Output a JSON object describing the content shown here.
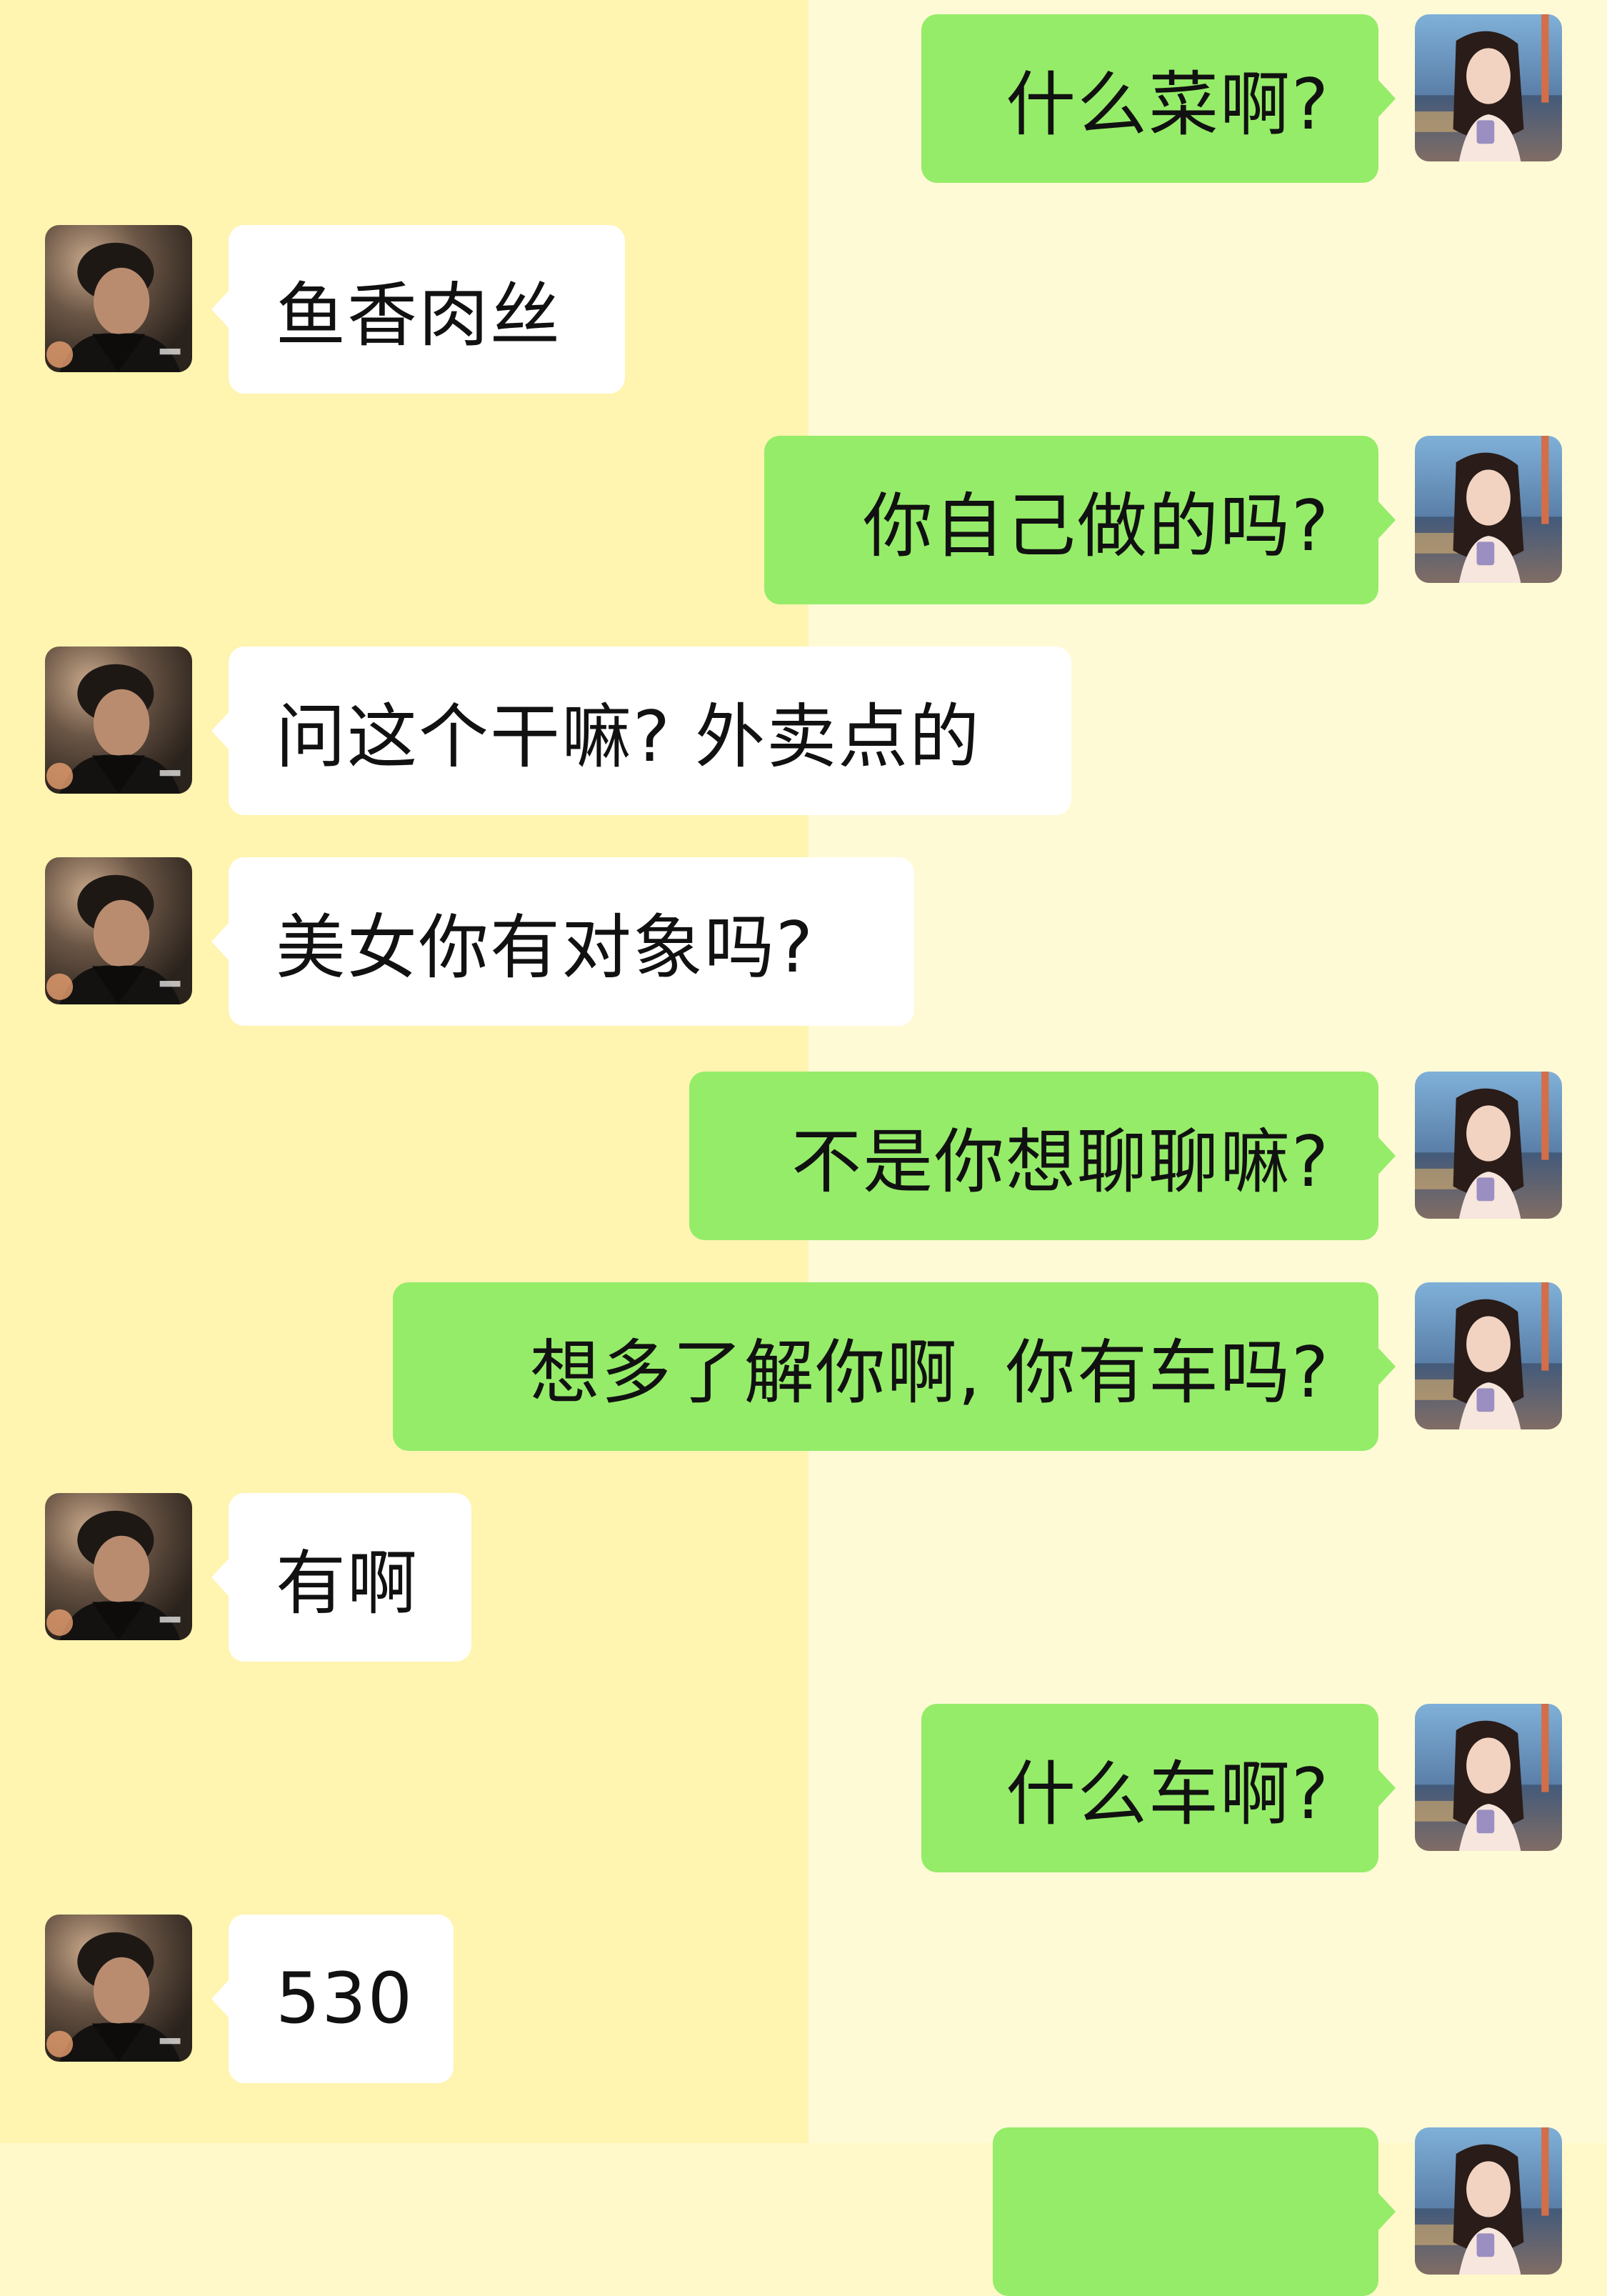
{
  "colors": {
    "bg_left": "#fff4b0",
    "bg_right": "#fffad6",
    "bubble_self": "#95ec69",
    "bubble_other": "#ffffff"
  },
  "icons": {
    "other_avatar": "male-avatar-icon",
    "self_avatar": "female-avatar-icon"
  },
  "messages": [
    {
      "side": "right",
      "text": "什么菜啊?"
    },
    {
      "side": "left",
      "text": "鱼香肉丝"
    },
    {
      "side": "right",
      "text": "你自己做的吗?"
    },
    {
      "side": "left",
      "text": "问这个干嘛? 外卖点的"
    },
    {
      "side": "left",
      "text": "美女你有对象吗?"
    },
    {
      "side": "right",
      "text": "不是你想聊聊嘛?"
    },
    {
      "side": "right",
      "text": "想多了解你啊, 你有车吗?"
    },
    {
      "side": "left",
      "text": "有啊"
    },
    {
      "side": "right",
      "text": "什么车啊?"
    },
    {
      "side": "left",
      "text": "530"
    }
  ]
}
